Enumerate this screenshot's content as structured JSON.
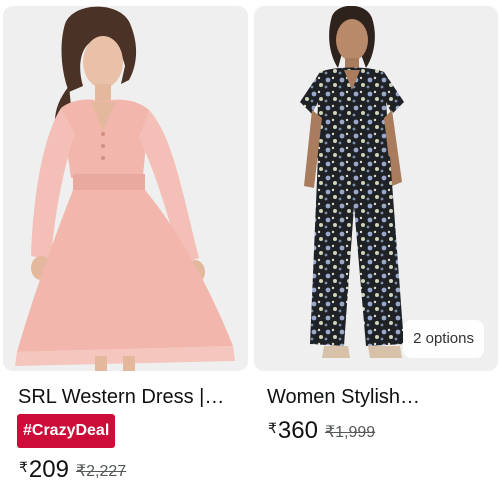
{
  "products": [
    {
      "title": "SRL Western Dress |…",
      "badge": "#CrazyDeal",
      "currency": "₹",
      "price": "209",
      "mrp": "₹2,227"
    },
    {
      "title": "Women Stylish…",
      "options": "2 options",
      "currency": "₹",
      "price": "360",
      "mrp": "₹1,999"
    }
  ],
  "colors": {
    "deal_red": "#cc0c39",
    "dress_pink": "#f2b6ad",
    "print_dark": "#1e2227"
  }
}
